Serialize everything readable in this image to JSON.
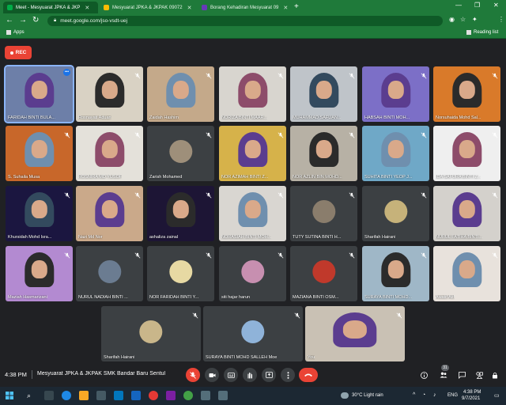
{
  "browser": {
    "tabs": [
      {
        "title": "Meet - Mesyuarat JPKA & JKP",
        "active": true,
        "favicon_color": "#00ac47"
      },
      {
        "title": "Mesyuarat JPKA & JKPAK 09072",
        "active": false,
        "favicon_color": "#fbbc04"
      },
      {
        "title": "Borang Kehadiran Mesyuarat 09",
        "active": false,
        "favicon_color": "#673ab7"
      }
    ],
    "new_tab_symbol": "+",
    "window_controls": {
      "minimize": "—",
      "restore": "❐",
      "close": "✕"
    },
    "url": "meet.google.com/jso-vsdt-uej",
    "bookmarks": [
      {
        "label": "Apps"
      },
      {
        "label": "Reading list"
      }
    ],
    "accent_color": "#1f7a3a"
  },
  "recording": {
    "label": "REC",
    "color": "#ea4335"
  },
  "participants": [
    {
      "name": "FARIDAH BINTI BULA...",
      "type": "video",
      "bg": "#6d7fa8",
      "muted": false,
      "more": true,
      "speaking": true
    },
    {
      "name": "Rosnayati Aduan",
      "type": "video",
      "bg": "#d9d2c4",
      "muted": true
    },
    {
      "name": "Zaidah Hashim",
      "type": "video",
      "bg": "#c4a98a",
      "muted": true
    },
    {
      "name": "NORIZA BINTI MAAR...",
      "type": "video",
      "bg": "#d8d5cf",
      "muted": true
    },
    {
      "name": "MUHAMMAD SAFUAN...",
      "type": "video",
      "bg": "#bfc4c9",
      "muted": true
    },
    {
      "name": "HABSAH BINTI MOH...",
      "type": "video",
      "bg": "#7c6fc7",
      "muted": true
    },
    {
      "name": "Norsuhaida Mohd Sal...",
      "type": "video",
      "bg": "#d97a2a",
      "muted": true
    },
    {
      "name": "S. Suhaila Musa",
      "type": "video",
      "bg": "#c8672a",
      "muted": true
    },
    {
      "name": "ROSNIRA MD YUSOF",
      "type": "video",
      "bg": "#e4e1da",
      "muted": true
    },
    {
      "name": "Zarish Mohamed",
      "type": "avatar",
      "bg": "#3c4043",
      "avatar_bg": "#9e8f7a",
      "muted": true
    },
    {
      "name": "NOR AZIMAH BINTI Z...",
      "type": "video",
      "bg": "#d6b24a",
      "muted": true
    },
    {
      "name": "NOR AZLIN BIN MOHD...",
      "type": "video",
      "bg": "#b7b1a5",
      "muted": true
    },
    {
      "name": "SUHITA BINTI YEOP J...",
      "type": "video",
      "bg": "#6fa8c7",
      "muted": true
    },
    {
      "name": "IDA SAFURA BINTI Z...",
      "type": "video",
      "bg": "#efefef",
      "muted": true
    },
    {
      "name": "Khursidah Mohd Isra...",
      "type": "video",
      "bg": "#1b1640",
      "muted": true
    },
    {
      "name": "Nazi Md Nor",
      "type": "video",
      "bg": "#caa98a",
      "muted": true
    },
    {
      "name": "ashaliza zainal",
      "type": "video",
      "bg": "#1d1535",
      "muted": true
    },
    {
      "name": "NORASIAH BINTI MOH...",
      "type": "video",
      "bg": "#d9d6d1",
      "muted": true
    },
    {
      "name": "TUTY SUTINA BINTI H...",
      "type": "avatar",
      "bg": "#3c4043",
      "avatar_bg": "#8a7d6c",
      "muted": true
    },
    {
      "name": "Sharifah Hairani",
      "type": "avatar",
      "bg": "#3c4043",
      "avatar_bg": "#c6b27a",
      "muted": true
    },
    {
      "name": "NURUL FATIHA BINTI...",
      "type": "video",
      "bg": "#d4d1cc",
      "muted": true
    },
    {
      "name": "Maziah Hasmarizani",
      "type": "video",
      "bg": "#b38ad1",
      "muted": true
    },
    {
      "name": "NURUL NADIAH BINTI ...",
      "type": "avatar",
      "bg": "#3c4043",
      "avatar_bg": "#6b7c91",
      "muted": true
    },
    {
      "name": "NOR FARIDAH BINTI Y...",
      "type": "avatar",
      "bg": "#3c4043",
      "avatar_bg": "#e7d9a3",
      "muted": true
    },
    {
      "name": "siti hajar harun",
      "type": "avatar",
      "bg": "#3c4043",
      "avatar_bg": "#c78fb0",
      "muted": true
    },
    {
      "name": "MAZIANA BINTI OSM...",
      "type": "avatar",
      "bg": "#3c4043",
      "avatar_bg": "#c0392b",
      "muted": true
    },
    {
      "name": "SURAYA BINTI MOHD...",
      "type": "video",
      "bg": "#9fb7c7",
      "muted": true
    },
    {
      "name": "Awatif Atif",
      "type": "video",
      "bg": "#e8e2dc",
      "muted": true
    },
    {
      "name": "Sharifah Hairani",
      "type": "avatar",
      "bg": "#3c4043",
      "avatar_bg": "#c9b68a",
      "muted": true
    },
    {
      "name": "SURAYA BINTI MOHD SALLEH Moe",
      "type": "avatar",
      "bg": "#3c4043",
      "avatar_bg": "#8fb3d9",
      "muted": true
    },
    {
      "name": "You",
      "type": "video",
      "bg": "#c9c1b4",
      "muted": true,
      "self": true
    }
  ],
  "controls": {
    "time": "4:38 PM",
    "meeting_title": "Mesyuarat JPKA & JKPAK SMK Bandar Baru Sentul",
    "people_count": "31"
  },
  "taskbar": {
    "weather": "30°C  Light rain",
    "language": "ENG",
    "clock_time": "4:38 PM",
    "clock_date": "9/7/2021"
  }
}
